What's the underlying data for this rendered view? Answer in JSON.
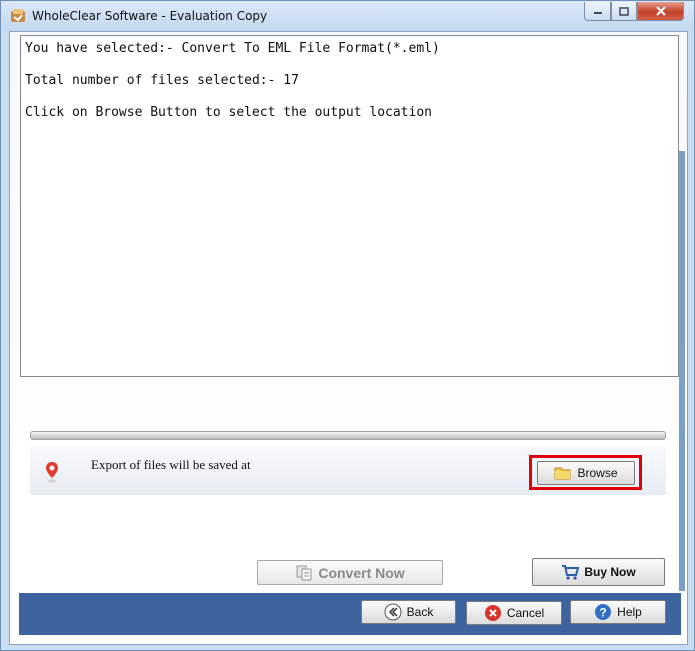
{
  "window": {
    "title": "WholeClear Software - Evaluation Copy",
    "icon": "app-logo-icon",
    "controls": [
      "minimize-icon",
      "maximize-icon",
      "close-icon"
    ]
  },
  "log": {
    "lines": [
      "You have selected:- Convert To EML File Format(*.eml)",
      "Total number of files selected:- 17",
      "Click on Browse Button to select the output location"
    ]
  },
  "export": {
    "label": "Export of files will be saved at",
    "icon": "location-pin-icon",
    "browse_label": "Browse",
    "browse_icon": "folder-icon",
    "highlight_color": "#e0000a"
  },
  "progress": {
    "value": 0
  },
  "actions": {
    "convert_label": "Convert Now",
    "convert_icon": "convert-icon",
    "convert_enabled": false,
    "buy_label": "Buy Now",
    "buy_icon": "cart-icon"
  },
  "nav": {
    "back_label": "Back",
    "back_icon": "back-arrow-icon",
    "cancel_label": "Cancel",
    "cancel_icon": "cancel-icon",
    "help_label": "Help",
    "help_icon": "help-icon"
  },
  "colors": {
    "bottom_bar": "#3e64a0",
    "window_frame": "#c9ddf1"
  }
}
